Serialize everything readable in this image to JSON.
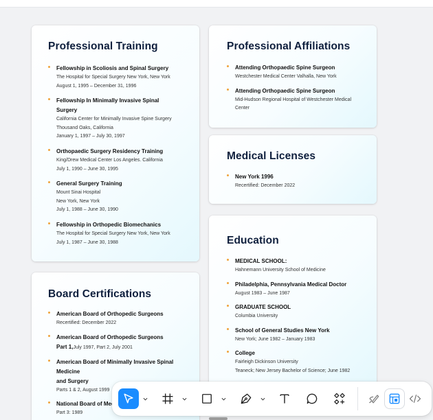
{
  "cards": {
    "training": {
      "title": "Professional Training",
      "items": [
        {
          "title": "Fellowship in Scoliosis and Spinal Surgery",
          "lines": [
            "The Hospital for Special Surgery New York, New York",
            "August 1, 1995 – December 31, 1996"
          ]
        },
        {
          "title": "Fellowship In Minimally Invasive Spinal Surgery",
          "lines": [
            "California Center for Minimally Invasive Spine Surgery",
            "Thousand Oaks, California",
            "January 1, 1997 – July 30, 1997"
          ]
        },
        {
          "title": "Orthopaedic Surgery Residency Training",
          "lines": [
            "King/Drew Medical Center Los Angeles. California",
            "July 1, 1990 – June 30, 1995"
          ]
        },
        {
          "title": "General Surgery Training",
          "lines": [
            "Mount Sinai Hospital",
            "New York, New York",
            "July 1, 1988 – June 30, 1990"
          ]
        },
        {
          "title": "Fellowship in Orthopedic Biomechanics",
          "lines": [
            "The Hospital for Special Surgery New York, New York",
            "July 1, 1987 – June 30, 1988"
          ]
        }
      ]
    },
    "affiliations": {
      "title": "Professional Affiliations",
      "items": [
        {
          "title": "Attending Orthopaedic Spine Surgeon",
          "lines": [
            "Westchester Medical Center Valhalla, New York"
          ]
        },
        {
          "title": "Attending Orthopaedic Spine Surgeon",
          "lines": [
            "Mid-Hudson Regional Hospital of Westchester Medical Center"
          ]
        }
      ]
    },
    "licenses": {
      "title": "Medical Licenses",
      "items": [
        {
          "title": "New York 1996",
          "lines": [
            "Recertified: December 2022"
          ]
        }
      ]
    },
    "education": {
      "title": "Education",
      "items": [
        {
          "title": "MEDICAL SCHOOL:",
          "lines": [
            "Hahnemann University School of Medicine"
          ]
        },
        {
          "title": "Philadelphia, Pennsylvania Medical Doctor",
          "lines": [
            "August 1983 – June 1987"
          ]
        },
        {
          "title": "GRADUATE SCHOOL",
          "lines": [
            "Columbia University"
          ]
        },
        {
          "title": "School of General Studies New York",
          "lines": [
            "New York; June 1982 – January 1983"
          ]
        },
        {
          "title": "College",
          "lines": [
            "Fairleigh Dickinson University",
            "Teaneck; New Jersey Bachelor of Science; June 1982"
          ]
        }
      ]
    },
    "board": {
      "title": "Board Certifications",
      "items": [
        {
          "title": "American Board of Orthopedic Surgeons",
          "lines": [
            "Recertified: December 2022"
          ]
        },
        {
          "title": "American Board of Orthopedic Surgeons",
          "title2": "Part 1,",
          "inline": "July 1997, Part 2, July 2001",
          "lines": []
        },
        {
          "title": "American Board of Minimally Invasive Spinal Medicine",
          "title2": "and Surgery",
          "lines": [
            "Parts 1 & 2, August 1999"
          ]
        },
        {
          "title": "National Board of Medical Examiners",
          "lines": [
            "Part 3: 1989"
          ]
        }
      ]
    }
  },
  "toolbar": {
    "tools": [
      {
        "name": "select-tool",
        "icon": "arrow-cursor-icon",
        "active": true,
        "caret": true
      },
      {
        "name": "frame-tool",
        "icon": "hash-frame-icon",
        "caret": true
      },
      {
        "name": "shape-tool",
        "icon": "square-icon",
        "caret": true
      },
      {
        "name": "pen-tool",
        "icon": "pen-nib-icon",
        "caret": true
      },
      {
        "name": "text-tool",
        "icon": "text-icon"
      },
      {
        "name": "comment-tool",
        "icon": "speech-bubble-icon"
      },
      {
        "name": "components-tool",
        "icon": "components-add-icon"
      },
      {
        "name": "draw-tool",
        "icon": "pencil-scribble-icon"
      },
      {
        "name": "dev-mode-tool",
        "icon": "layout-inspect-icon",
        "boxed": true
      },
      {
        "name": "code-tool",
        "icon": "code-brackets-icon"
      }
    ],
    "colors": {
      "active": "#1a8cff",
      "icon": "#222222",
      "bullet": "#f0a33c"
    }
  }
}
